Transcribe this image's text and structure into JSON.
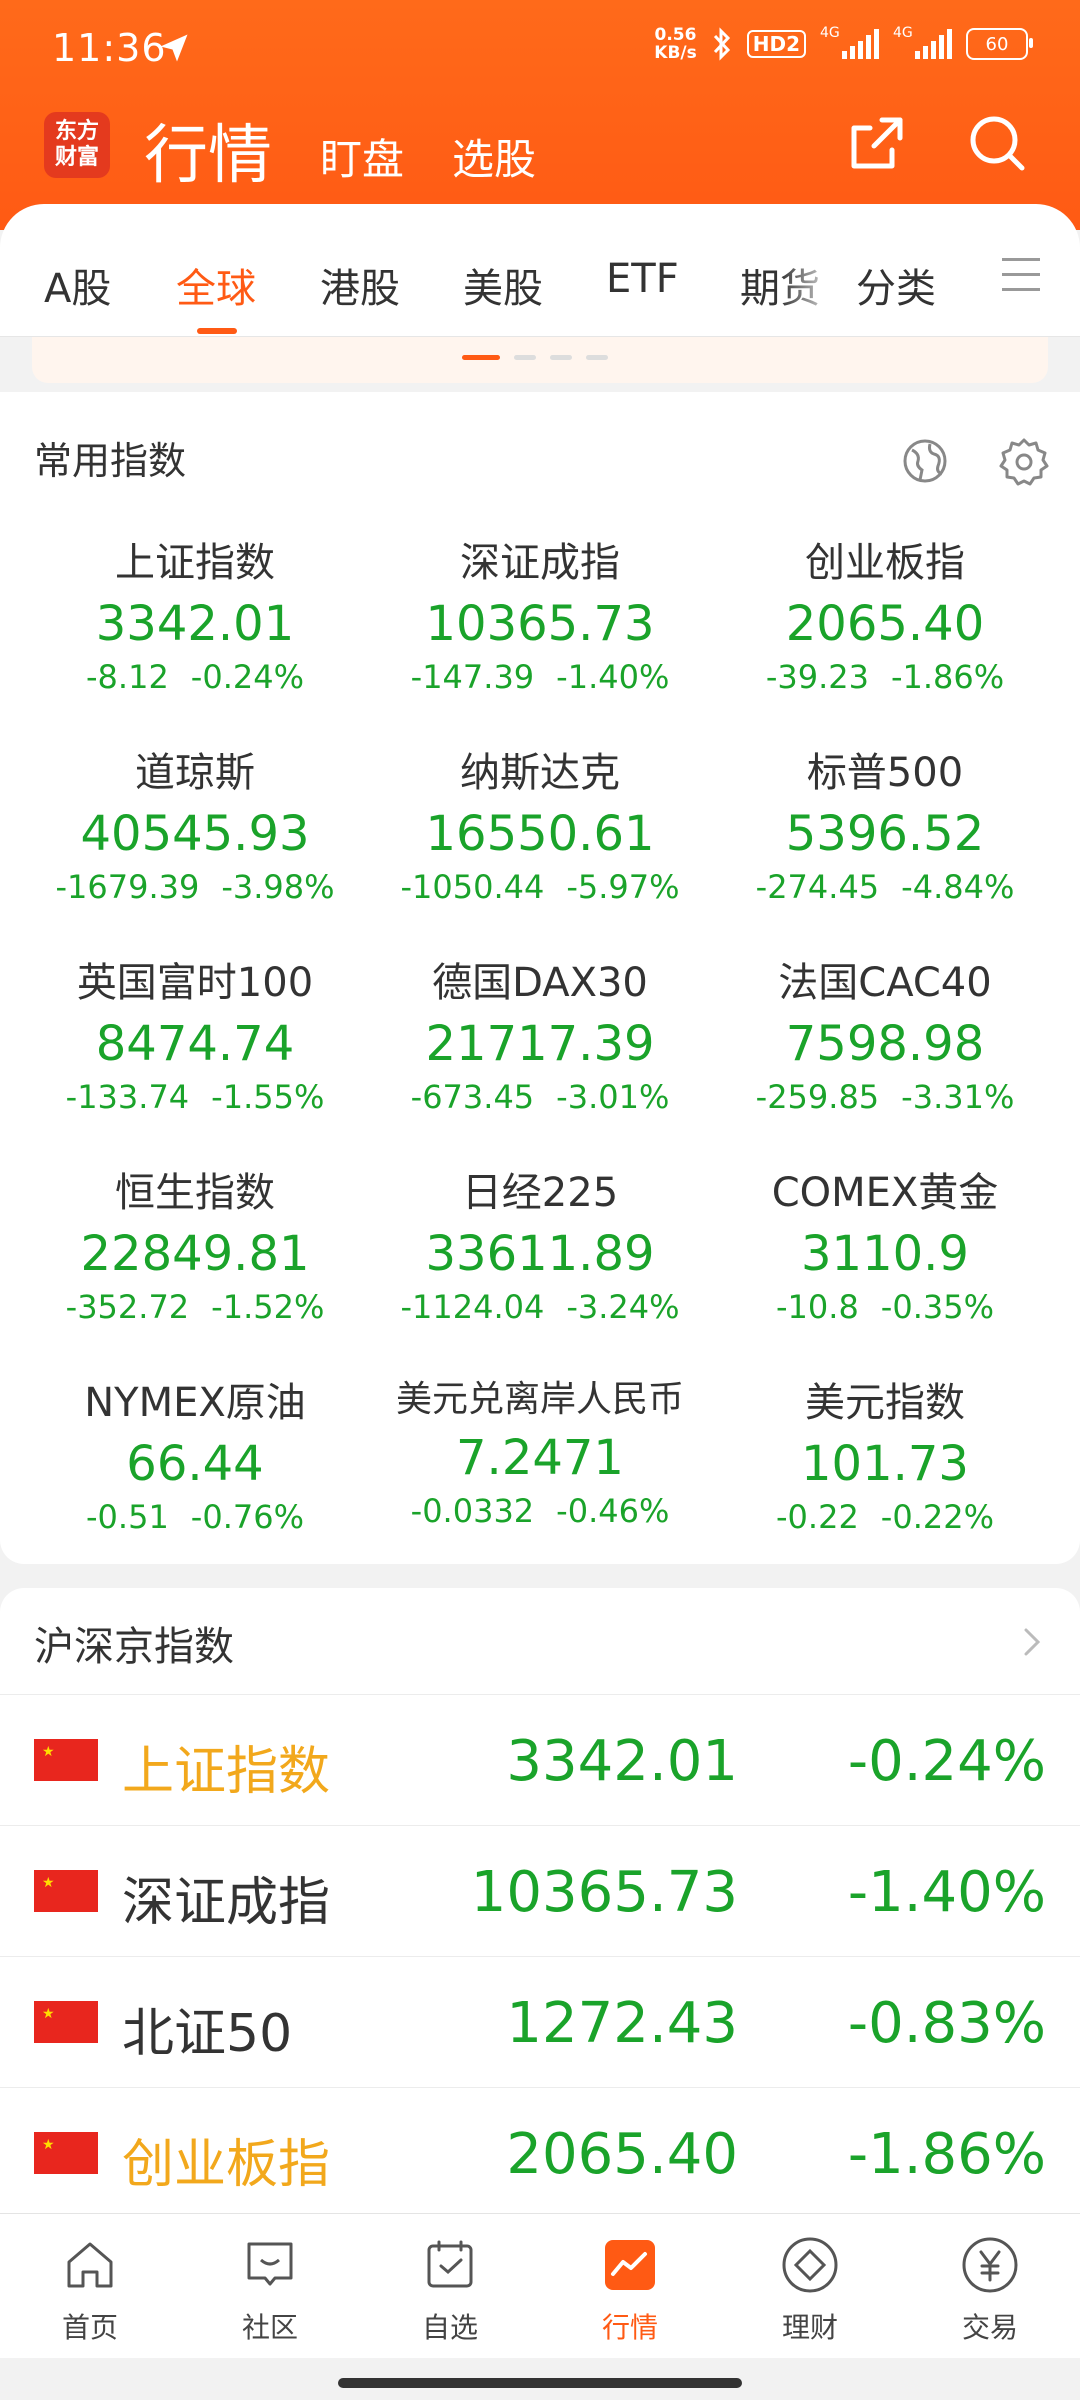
{
  "status_bar": {
    "time": "11:36",
    "speed_value": "0.56",
    "speed_unit": "KB/s",
    "hd_badge": "HD2",
    "signal1_label": "4G",
    "signal2_label": "4G",
    "battery": "60"
  },
  "header": {
    "logo_text": "东方财富",
    "title": "行情",
    "tabs": [
      "盯盘",
      "选股"
    ]
  },
  "market_tabs": {
    "items": [
      "A股",
      "全球",
      "港股",
      "美股",
      "ETF",
      "期货",
      "分类"
    ],
    "active": "全球"
  },
  "common_indices": {
    "title": "常用指数",
    "items": [
      {
        "name": "上证指数",
        "value": "3342.01",
        "change": "-8.12",
        "pct": "-0.24%"
      },
      {
        "name": "深证成指",
        "value": "10365.73",
        "change": "-147.39",
        "pct": "-1.40%"
      },
      {
        "name": "创业板指",
        "value": "2065.40",
        "change": "-39.23",
        "pct": "-1.86%"
      },
      {
        "name": "道琼斯",
        "value": "40545.93",
        "change": "-1679.39",
        "pct": "-3.98%"
      },
      {
        "name": "纳斯达克",
        "value": "16550.61",
        "change": "-1050.44",
        "pct": "-5.97%"
      },
      {
        "name": "标普500",
        "value": "5396.52",
        "change": "-274.45",
        "pct": "-4.84%"
      },
      {
        "name": "英国富时100",
        "value": "8474.74",
        "change": "-133.74",
        "pct": "-1.55%"
      },
      {
        "name": "德国DAX30",
        "value": "21717.39",
        "change": "-673.45",
        "pct": "-3.01%"
      },
      {
        "name": "法国CAC40",
        "value": "7598.98",
        "change": "-259.85",
        "pct": "-3.31%"
      },
      {
        "name": "恒生指数",
        "value": "22849.81",
        "change": "-352.72",
        "pct": "-1.52%"
      },
      {
        "name": "日经225",
        "value": "33611.89",
        "change": "-1124.04",
        "pct": "-3.24%"
      },
      {
        "name": "COMEX黄金",
        "value": "3110.9",
        "change": "-10.8",
        "pct": "-0.35%"
      },
      {
        "name": "NYMEX原油",
        "value": "66.44",
        "change": "-0.51",
        "pct": "-0.76%"
      },
      {
        "name": "美元兑离岸人民币",
        "value": "7.2471",
        "change": "-0.0332",
        "pct": "-0.46%"
      },
      {
        "name": "美元指数",
        "value": "101.73",
        "change": "-0.22",
        "pct": "-0.22%"
      }
    ]
  },
  "hsj_indices": {
    "title": "沪深京指数",
    "rows": [
      {
        "name": "上证指数",
        "value": "3342.01",
        "pct": "-0.24%",
        "highlight": true
      },
      {
        "name": "深证成指",
        "value": "10365.73",
        "pct": "-1.40%",
        "highlight": false
      },
      {
        "name": "北证50",
        "value": "1272.43",
        "pct": "-0.83%",
        "highlight": false
      },
      {
        "name": "创业板指",
        "value": "2065.40",
        "pct": "-1.86%",
        "highlight": true
      }
    ]
  },
  "bottom_nav": {
    "items": [
      "首页",
      "社区",
      "自选",
      "行情",
      "理财",
      "交易"
    ],
    "active": "行情"
  },
  "colors": {
    "brand_orange": "#ff5a14",
    "down_green": "#1aa32a",
    "highlight_yellow": "#f2a81c"
  }
}
